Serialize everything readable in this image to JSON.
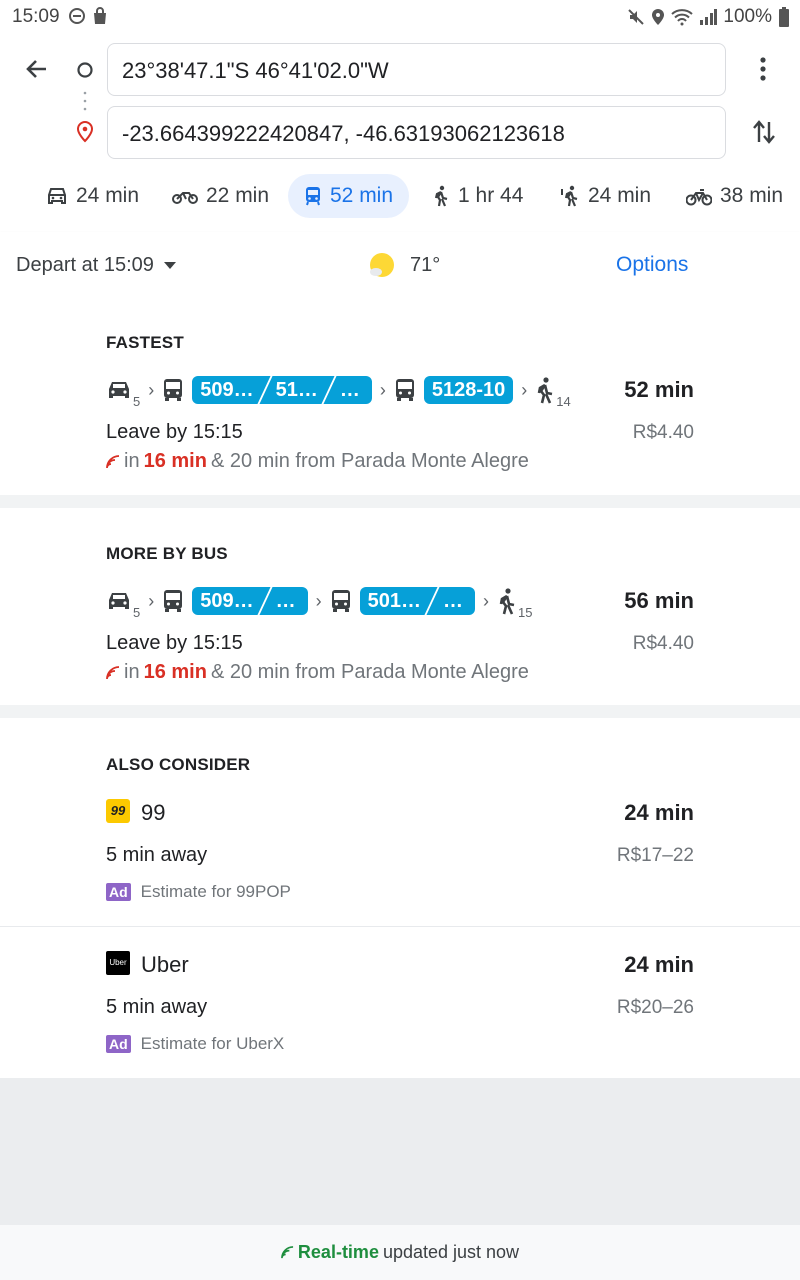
{
  "status_bar": {
    "time": "15:09",
    "battery": "100%"
  },
  "search": {
    "origin": "23°38'47.1\"S 46°41'02.0\"W",
    "destination": "-23.664399222420847, -46.63193062123618"
  },
  "modes": [
    {
      "label": "24 min",
      "icon": "car-icon"
    },
    {
      "label": "22 min",
      "icon": "motorcycle-icon"
    },
    {
      "label": "52 min",
      "icon": "transit-icon",
      "selected": true
    },
    {
      "label": "1 hr 44",
      "icon": "walk-icon"
    },
    {
      "label": "24 min",
      "icon": "ride-service-icon"
    },
    {
      "label": "38 min",
      "icon": "bike-icon"
    }
  ],
  "depart": {
    "label": "Depart at 15:09",
    "temperature": "71°",
    "options": "Options"
  },
  "fastest": {
    "title": "FASTEST",
    "car_sub": "5",
    "bus1": [
      "509…",
      "51…",
      "…"
    ],
    "bus2": [
      "5128-10"
    ],
    "walk_sub": "14",
    "duration": "52 min",
    "leave": "Leave by 15:15",
    "price": "R$4.40",
    "rt_prefix": "in",
    "rt_time": "16 min",
    "rt_suffix": "& 20 min from Parada Monte Alegre"
  },
  "more_bus": {
    "title": "MORE BY BUS",
    "car_sub": "5",
    "bus1": [
      "509…",
      "…"
    ],
    "bus2": [
      "501…",
      "…"
    ],
    "walk_sub": "15",
    "duration": "56 min",
    "leave": "Leave by 15:15",
    "price": "R$4.40",
    "rt_prefix": "in",
    "rt_time": "16 min",
    "rt_suffix": "& 20 min from Parada Monte Alegre"
  },
  "also_consider": {
    "title": "ALSO CONSIDER",
    "items": [
      {
        "logo_text": "99",
        "name": "99",
        "duration": "24 min",
        "away": "5 min away",
        "price": "R$17–22",
        "ad": "Ad",
        "estimate": "Estimate for 99POP"
      },
      {
        "logo_text": "Uber",
        "name": "Uber",
        "duration": "24 min",
        "away": "5 min away",
        "price": "R$20–26",
        "ad": "Ad",
        "estimate": "Estimate for UberX"
      }
    ]
  },
  "footer": {
    "realtime": "Real-time",
    "updated": "updated just now"
  },
  "colors": {
    "accent": "#1a73e8",
    "transit_pill": "#06a0d8",
    "realtime_red": "#d93025",
    "realtime_green": "#1e8e3e",
    "ad_purple": "#8e65c7"
  }
}
